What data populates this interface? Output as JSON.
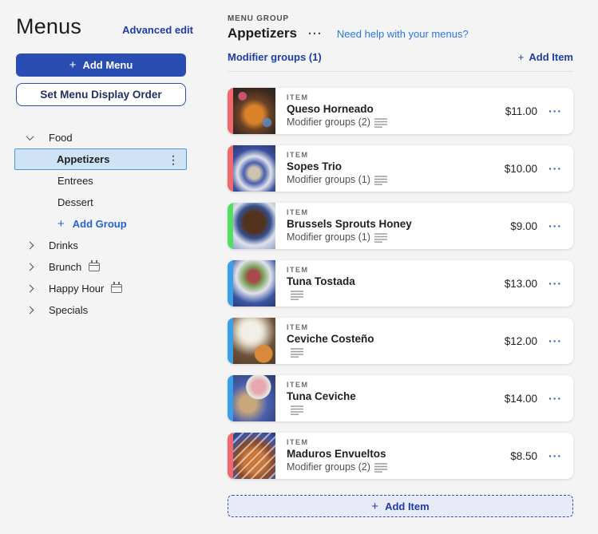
{
  "labels": {
    "item_eyebrow": "ITEM",
    "more_icon": "···",
    "kebab_icon": "⋮",
    "plus": "+"
  },
  "sidebar": {
    "title": "Menus",
    "advanced_edit_link": "Advanced edit",
    "add_menu_button": "Add Menu",
    "set_menu_display_order_button": "Set Menu Display Order",
    "tree": {
      "food": "Food",
      "appetizers": "Appetizers",
      "entrees": "Entrees",
      "dessert": "Dessert",
      "add_group": "Add Group",
      "drinks": "Drinks",
      "brunch": "Brunch",
      "happy_hour": "Happy Hour",
      "specials": "Specials"
    }
  },
  "header": {
    "eyebrow": "MENU GROUP",
    "title": "Appetizers",
    "help_link": "Need help with your menus?",
    "modifier_groups_link": "Modifier groups (1)",
    "add_item_link": "Add Item"
  },
  "items": [
    {
      "name": "Queso Horneado",
      "modifiers": "Modifier groups (2)",
      "price": "$11.00",
      "stripe_color": "#f1696f"
    },
    {
      "name": "Sopes Trio",
      "modifiers": "Modifier groups (1)",
      "price": "$10.00",
      "stripe_color": "#f1696f"
    },
    {
      "name": "Brussels Sprouts Honey",
      "modifiers": "Modifier groups (1)",
      "price": "$9.00",
      "stripe_color": "#52df63"
    },
    {
      "name": "Tuna Tostada",
      "modifiers": "",
      "price": "$13.00",
      "stripe_color": "#39a0e8"
    },
    {
      "name": "Ceviche Costeño",
      "modifiers": "",
      "price": "$12.00",
      "stripe_color": "#39a0e8"
    },
    {
      "name": "Tuna Ceviche",
      "modifiers": "",
      "price": "$14.00",
      "stripe_color": "#39a0e8"
    },
    {
      "name": "Maduros Envueltos",
      "modifiers": "Modifier groups (2)",
      "price": "$8.50",
      "stripe_color": "#f1696f"
    }
  ],
  "footer": {
    "add_item_button": "Add Item"
  },
  "colors": {
    "primary_button": "#2a4db4",
    "link_dark_blue": "#1e3ca8",
    "link_bright_blue": "#2b76e8",
    "selected_row_bg": "#cfe3f6",
    "selected_row_border": "#4d95dd",
    "stripe_red": "#f1696f",
    "stripe_green": "#52df63",
    "stripe_blue": "#39a0e8"
  }
}
